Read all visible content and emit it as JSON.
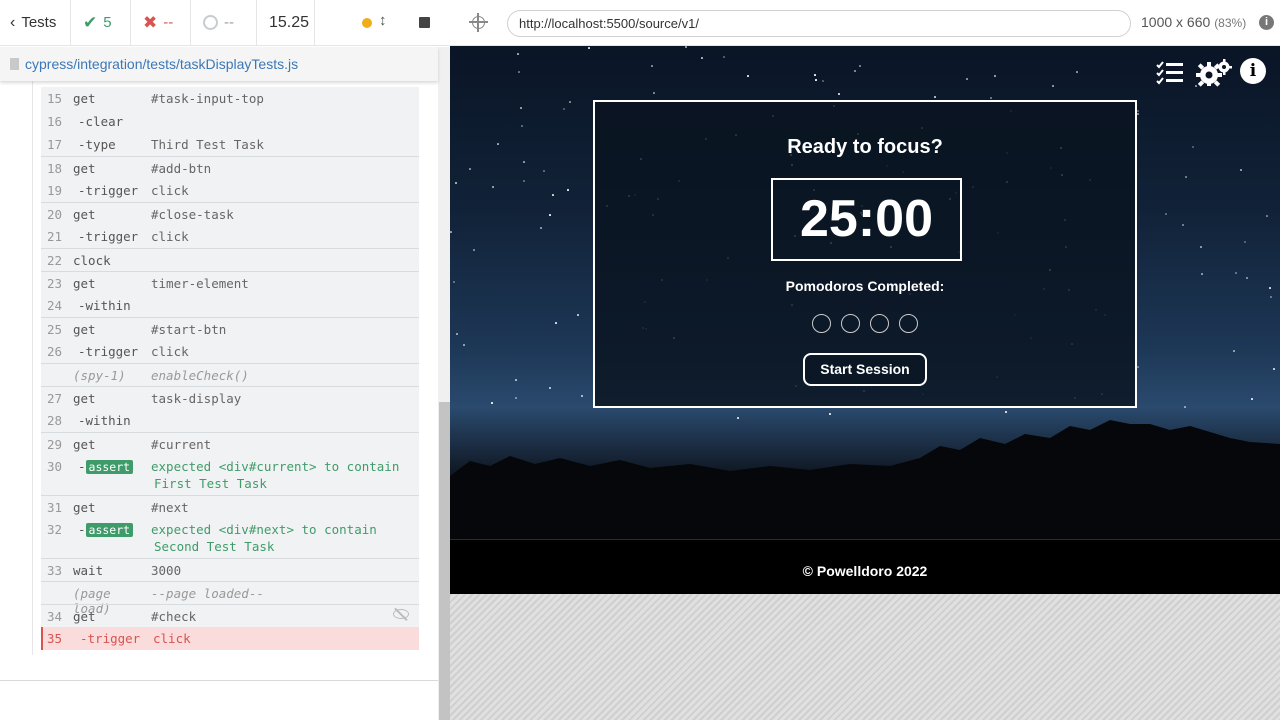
{
  "reporter": {
    "tests_label": "Tests",
    "passed": "5",
    "failed": "--",
    "pending": "--",
    "duration": "15.25",
    "spec_path": "cypress/integration/tests/taskDisplayTests.js"
  },
  "commands": [
    {
      "num": "15",
      "cmd": "get",
      "arg": "#task-input-top",
      "child": false,
      "sep": false
    },
    {
      "num": "16",
      "cmd": "-clear",
      "arg": "",
      "child": true,
      "sep": false
    },
    {
      "num": "17",
      "cmd": "-type",
      "arg": "Third Test Task",
      "child": true,
      "sep": false
    },
    {
      "num": "18",
      "cmd": "get",
      "arg": "#add-btn",
      "child": false,
      "sep": true
    },
    {
      "num": "19",
      "cmd": "-trigger",
      "arg": "click",
      "child": true,
      "sep": false
    },
    {
      "num": "20",
      "cmd": "get",
      "arg": "#close-task",
      "child": false,
      "sep": true
    },
    {
      "num": "21",
      "cmd": "-trigger",
      "arg": "click",
      "child": true,
      "sep": false
    },
    {
      "num": "22",
      "cmd": "clock",
      "arg": "",
      "child": false,
      "sep": true
    },
    {
      "num": "23",
      "cmd": "get",
      "arg": "timer-element",
      "child": false,
      "sep": true
    },
    {
      "num": "24",
      "cmd": "-within",
      "arg": "",
      "child": true,
      "sep": false
    },
    {
      "num": "25",
      "cmd": "get",
      "arg": "#start-btn",
      "child": false,
      "sep": true
    },
    {
      "num": "26",
      "cmd": "-trigger",
      "arg": "click",
      "child": true,
      "sep": false
    },
    {
      "num": "",
      "cmd": "(spy-1)",
      "arg": "enableCheck()",
      "italic": true,
      "sep": true
    },
    {
      "num": "27",
      "cmd": "get",
      "arg": "task-display",
      "child": false,
      "sep": true
    },
    {
      "num": "28",
      "cmd": "-within",
      "arg": "",
      "child": true,
      "sep": false
    },
    {
      "num": "29",
      "cmd": "get",
      "arg": "#current",
      "child": false,
      "sep": true
    },
    {
      "num": "30",
      "cmd": "-",
      "assert": "assert",
      "arg": "expected <div#current> to contain",
      "arg2": "First Test Task",
      "sep": false
    },
    {
      "num": "31",
      "cmd": "get",
      "arg": "#next",
      "child": false,
      "sep": true
    },
    {
      "num": "32",
      "cmd": "-",
      "assert": "assert",
      "arg": "expected <div#next> to contain",
      "arg2": "Second Test Task",
      "sep": false
    },
    {
      "num": "33",
      "cmd": "wait",
      "arg": "3000",
      "child": false,
      "sep": true
    },
    {
      "num": "",
      "cmd": "(page load)",
      "arg": "--page loaded--",
      "italic": true,
      "sep": true
    },
    {
      "num": "34",
      "cmd": "get",
      "arg": "#check",
      "child": false,
      "sep": true,
      "hidden": true
    },
    {
      "num": "35",
      "cmd": "-trigger",
      "arg": "click",
      "child": true,
      "sep": false,
      "failed": true
    }
  ],
  "aut": {
    "url": "http://localhost:5500/source/v1/",
    "viewport": "1000 x 660",
    "zoom": "(83%)",
    "ready_title": "Ready to focus?",
    "time": "25:00",
    "pomodoros_label": "Pomodoros Completed:",
    "pomodoros_completed": 0,
    "pomodoros_total": 4,
    "start_label": "Start Session",
    "footer": "© Powelldoro 2022"
  },
  "colors": {
    "pass": "#3f9c6a",
    "fail": "#d9534f",
    "link": "#3b77b8"
  }
}
